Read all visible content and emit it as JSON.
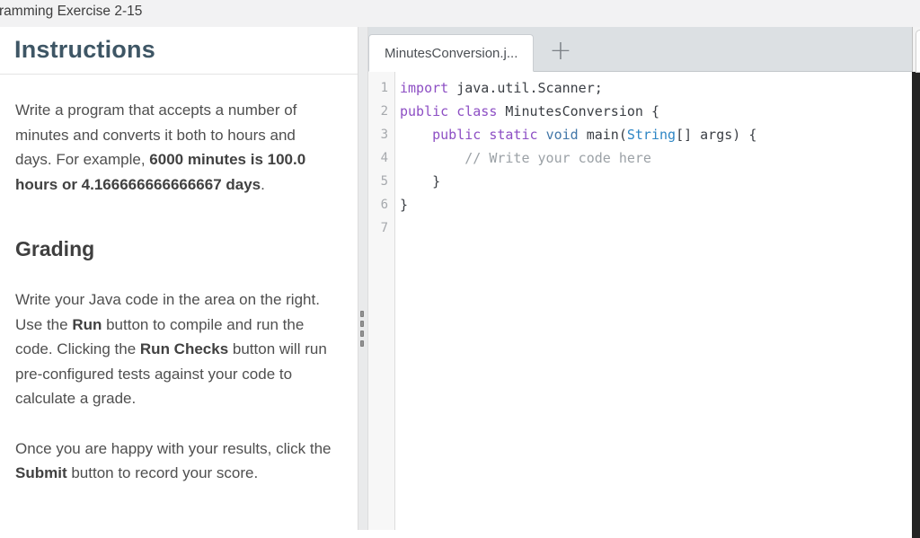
{
  "topbar": {
    "title": "ramming Exercise 2-15"
  },
  "instructions_panel": {
    "title": "Instructions",
    "intro_paragraphs": [
      {
        "segments": [
          {
            "text": "Write a program that accepts a number of minutes and converts it both to hours and days. For example, ",
            "bold": false
          },
          {
            "text": "6000 minutes is 100.0 hours or 4.166666666666667 days",
            "bold": true
          },
          {
            "text": ".",
            "bold": false
          }
        ]
      }
    ],
    "grading_title": "Grading",
    "grading_paragraphs": [
      {
        "segments": [
          {
            "text": "Write your Java code in the area on the right. Use the ",
            "bold": false
          },
          {
            "text": "Run",
            "bold": true
          },
          {
            "text": " button to compile and run the code. Clicking the ",
            "bold": false
          },
          {
            "text": "Run Checks",
            "bold": true
          },
          {
            "text": " button will run pre-configured tests against your code to calculate a grade.",
            "bold": false
          }
        ]
      },
      {
        "segments": [
          {
            "text": "Once you are happy with your results, click the ",
            "bold": false
          },
          {
            "text": "Submit",
            "bold": true
          },
          {
            "text": " button to record your score.",
            "bold": false
          }
        ]
      }
    ]
  },
  "editor": {
    "tab_label": "MinutesConversion.j...",
    "new_tab_icon": "+",
    "line_numbers": [
      "1",
      "2",
      "3",
      "4",
      "5",
      "6",
      "7"
    ],
    "code_lines": [
      [
        {
          "text": "import",
          "type": "keyword"
        },
        {
          "text": " java.util.Scanner;",
          "type": "plain"
        }
      ],
      [
        {
          "text": "public class",
          "type": "keyword"
        },
        {
          "text": " MinutesConversion {",
          "type": "plain"
        }
      ],
      [
        {
          "text": "    ",
          "type": "plain"
        },
        {
          "text": "public static",
          "type": "keyword"
        },
        {
          "text": " ",
          "type": "plain"
        },
        {
          "text": "void",
          "type": "type"
        },
        {
          "text": " main(",
          "type": "plain"
        },
        {
          "text": "String",
          "type": "class"
        },
        {
          "text": "[] args) {",
          "type": "plain"
        }
      ],
      [
        {
          "text": "        ",
          "type": "plain"
        },
        {
          "text": "// Write your code here",
          "type": "comment"
        }
      ],
      [
        {
          "text": "    }",
          "type": "plain"
        }
      ],
      [
        {
          "text": "}",
          "type": "plain"
        }
      ],
      []
    ]
  },
  "colors": {
    "keyword": "#8d4fc4",
    "type_keyword": "#4377a8",
    "class_name": "#2e86c5",
    "comment": "#9ba1a6",
    "code_default": "#3a3e44",
    "heading_accent": "#3e5665",
    "dark_panel_edge": "#232323"
  }
}
